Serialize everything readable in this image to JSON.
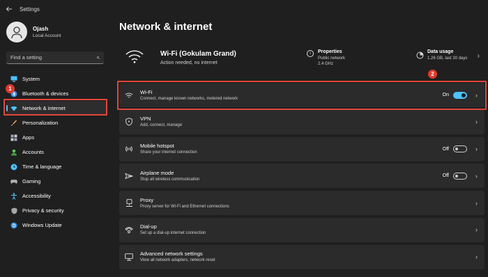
{
  "titlebar": {
    "title": "Settings",
    "back_icon": "back-arrow-icon"
  },
  "profile": {
    "name": "Ojash",
    "account": "Local Account"
  },
  "search": {
    "placeholder": "Find a setting"
  },
  "nav": {
    "items": [
      {
        "label": "System",
        "icon": "monitor-icon",
        "color": "#4cc2ff"
      },
      {
        "label": "Bluetooth & devices",
        "icon": "bluetooth-icon",
        "color": "#3b8eea"
      },
      {
        "label": "Network & internet",
        "icon": "wifi-icon",
        "color": "#4cc2ff",
        "active": true
      },
      {
        "label": "Personalization",
        "icon": "brush-icon",
        "color": "#f0a15a"
      },
      {
        "label": "Apps",
        "icon": "apps-icon",
        "color": "#9aa4b4"
      },
      {
        "label": "Accounts",
        "icon": "person-icon",
        "color": "#5fc35f"
      },
      {
        "label": "Time & language",
        "icon": "globe-clock-icon",
        "color": "#4cc2ff"
      },
      {
        "label": "Gaming",
        "icon": "gamepad-icon",
        "color": "#a0a0a0"
      },
      {
        "label": "Accessibility",
        "icon": "accessibility-icon",
        "color": "#4cc2ff"
      },
      {
        "label": "Privacy & security",
        "icon": "shield-icon",
        "color": "#a0a0a0"
      },
      {
        "label": "Windows Update",
        "icon": "update-icon",
        "color": "#4cc2ff"
      }
    ]
  },
  "main": {
    "title": "Network & internet",
    "hero": {
      "network_name": "Wi-Fi (Gokulam Grand)",
      "network_status": "Action needed, no internet",
      "properties_title": "Properties",
      "properties_line1": "Public network",
      "properties_line2": "2.4 GHz",
      "usage_title": "Data usage",
      "usage_detail": "1.26 GB, last 30 days"
    },
    "rows": [
      {
        "title": "Wi-Fi",
        "subtitle": "Connect, manage known networks, metered network",
        "state": "On",
        "toggle": "on",
        "icon": "wifi-icon"
      },
      {
        "title": "VPN",
        "subtitle": "Add, connect, manage",
        "icon": "vpn-shield-icon"
      },
      {
        "title": "Mobile hotspot",
        "subtitle": "Share your internet connection",
        "state": "Off",
        "toggle": "off",
        "icon": "hotspot-icon"
      },
      {
        "title": "Airplane mode",
        "subtitle": "Stop all wireless communication",
        "state": "Off",
        "toggle": "off",
        "icon": "airplane-icon"
      },
      {
        "title": "Proxy",
        "subtitle": "Proxy server for Wi-Fi and Ethernet connections",
        "icon": "proxy-icon"
      },
      {
        "title": "Dial-up",
        "subtitle": "Set up a dial-up internet connection",
        "icon": "dialup-icon"
      },
      {
        "title": "Advanced network settings",
        "subtitle": "View all network adapters, network reset",
        "icon": "monitor-network-icon"
      }
    ]
  },
  "annotations": {
    "badge1": "1",
    "badge2": "2",
    "color": "#e4453a"
  },
  "colors": {
    "accent": "#4cc2ff",
    "background": "#1f1f1f",
    "card": "#2b2b2b"
  }
}
